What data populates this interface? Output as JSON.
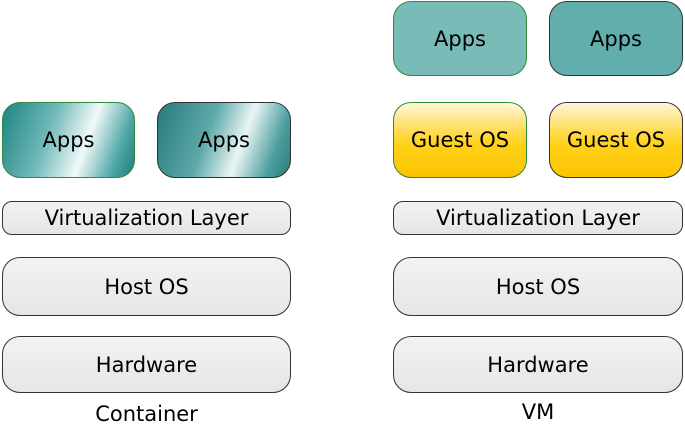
{
  "container": {
    "caption": "Container",
    "apps_left": "Apps",
    "apps_right": "Apps",
    "virtualization": "Virtualization Layer",
    "host_os": "Host OS",
    "hardware": "Hardware"
  },
  "vm": {
    "caption": "VM",
    "apps_left": "Apps",
    "apps_right": "Apps",
    "guest_left": "Guest OS",
    "guest_right": "Guest OS",
    "virtualization": "Virtualization Layer",
    "host_os": "Host OS",
    "hardware": "Hardware"
  },
  "colors": {
    "apps_teal_light": "#79bcb7",
    "apps_teal_dark": "#61aeac",
    "guest_os_yellow": "#ffd21a",
    "layer_gray": "#e8e8e8",
    "green_border": "#2e8b3a"
  }
}
